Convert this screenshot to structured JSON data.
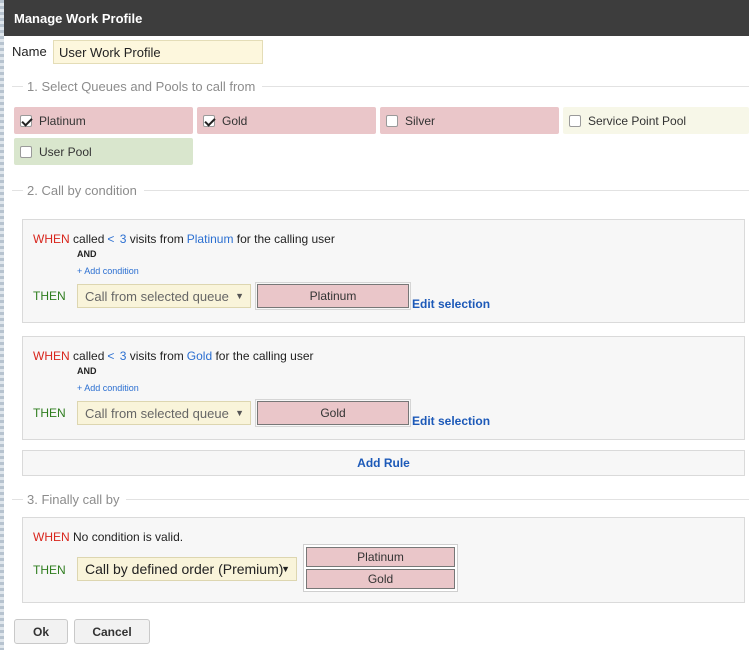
{
  "dialog": {
    "title": "Manage Work Profile"
  },
  "name_field": {
    "label": "Name",
    "value": "User Work Profile"
  },
  "sections": {
    "queues_title": "1. Select Queues and Pools to call from",
    "conditions_title": "2. Call by condition",
    "finally_title": "3. Finally call by"
  },
  "queues": [
    {
      "label": "Platinum",
      "checked": true,
      "color": "#eac6c9"
    },
    {
      "label": "Gold",
      "checked": true,
      "color": "#eac6c9"
    },
    {
      "label": "Silver",
      "checked": false,
      "color": "#eac6c9"
    },
    {
      "label": "Service Point Pool",
      "checked": false,
      "color": "#f7f7e8"
    },
    {
      "label": "User Pool",
      "checked": false,
      "color": "#d9e6cd"
    }
  ],
  "rules": [
    {
      "when": "WHEN",
      "called": "called",
      "operator": "<",
      "count": "3",
      "visits_from": "visits from",
      "queue": "Platinum",
      "suffix": "for the calling user",
      "and": "AND",
      "add_condition": "+ Add condition",
      "then": "THEN",
      "action": "Call from selected queue",
      "selected_queue": "Platinum",
      "edit_selection": "Edit selection"
    },
    {
      "when": "WHEN",
      "called": "called",
      "operator": "<",
      "count": "3",
      "visits_from": "visits from",
      "queue": "Gold",
      "suffix": "for the calling user",
      "and": "AND",
      "add_condition": "+ Add condition",
      "then": "THEN",
      "action": "Call from selected queue",
      "selected_queue": "Gold",
      "edit_selection": "Edit selection"
    }
  ],
  "add_rule_label": "Add Rule",
  "final": {
    "when": "WHEN",
    "condition_text": "No condition is valid.",
    "then": "THEN",
    "action": "Call by defined order (Premium)",
    "order": [
      "Platinum",
      "Gold"
    ]
  },
  "buttons": {
    "ok": "Ok",
    "cancel": "Cancel"
  },
  "icons": {
    "dropdown": "chevron-down-icon",
    "checkbox": "checkbox-icon"
  },
  "colors": {
    "titlebar": "#3d3d3d",
    "when_keyword": "#d8251c",
    "then_keyword": "#2e7d1e",
    "link": "#1c59b8",
    "premium_queue": "#eac6c9",
    "user_pool": "#d9e6cd"
  }
}
